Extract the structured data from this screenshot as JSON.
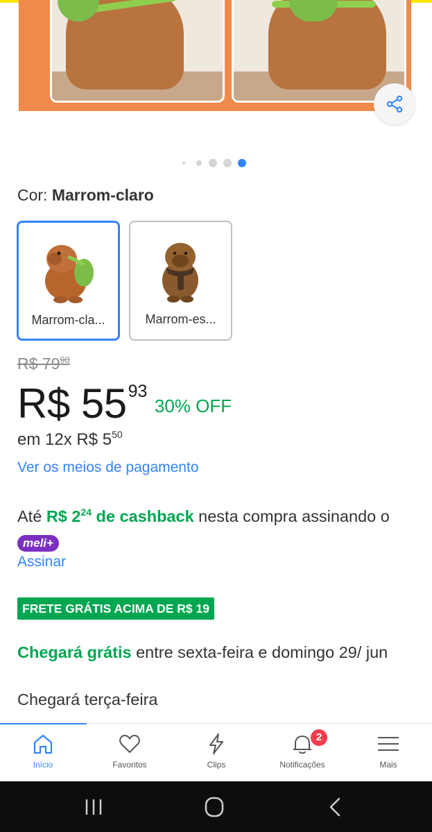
{
  "carousel": {
    "dots_count": 5,
    "active_dot": 4,
    "share_icon": "share-icon"
  },
  "color": {
    "label": "Cor:",
    "selected": "Marrom-claro",
    "options": [
      {
        "label": "Marrom-cla...",
        "selected": true
      },
      {
        "label": "Marrom-es...",
        "selected": false
      }
    ]
  },
  "price": {
    "old_main": "R$ 79",
    "old_cents": "90",
    "main": "R$ 55",
    "cents": "93",
    "discount": "30% OFF",
    "installments_prefix": "em 12x R$ 5",
    "installments_cents": "50",
    "payment_link": "Ver os meios de pagamento"
  },
  "cashback": {
    "prefix": "Até ",
    "amount_main": "R$ 2",
    "amount_cents": "24",
    "amount_suffix": " de cashback",
    "middle": " nesta compra assinando o ",
    "badge": "meli+",
    "subscribe_link": "Assinar"
  },
  "shipping": {
    "tag": "FRETE GRÁTIS ACIMA DE R$ 19",
    "free_label": "Chegará grátis",
    "free_detail": " entre sexta-feira e domingo 29/ jun",
    "other": "Chegará terça-feira"
  },
  "nav": {
    "items": [
      {
        "label": "Início",
        "icon": "home-icon",
        "active": true
      },
      {
        "label": "Favoritos",
        "icon": "heart-icon",
        "active": false
      },
      {
        "label": "Clips",
        "icon": "lightning-icon",
        "active": false
      },
      {
        "label": "Notificações",
        "icon": "bell-icon",
        "active": false,
        "badge": "2"
      },
      {
        "label": "Mais",
        "icon": "menu-icon",
        "active": false
      }
    ]
  },
  "colors": {
    "accent": "#3483fa",
    "green": "#00a650",
    "badge_red": "#f23d4f",
    "meli_purple": "#7b2fbf"
  }
}
